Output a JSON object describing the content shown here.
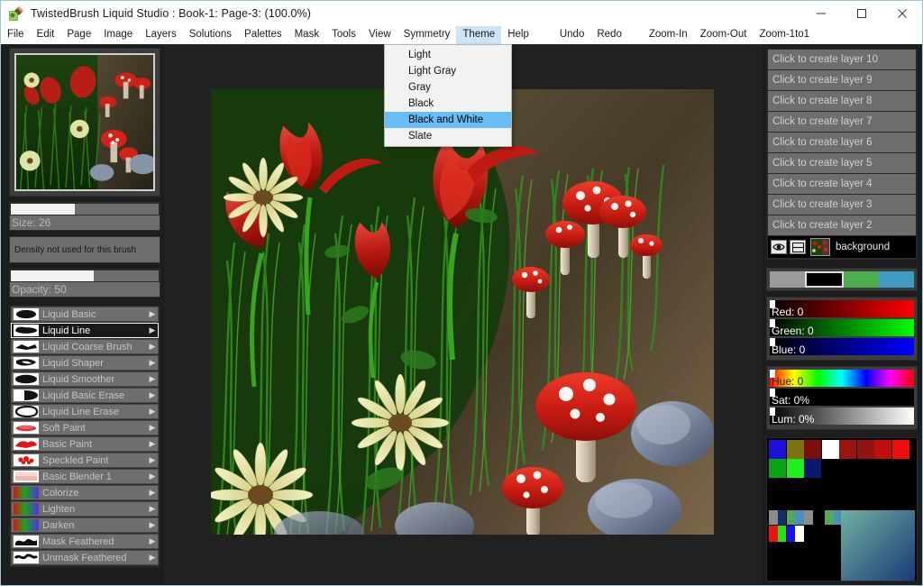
{
  "window": {
    "title": "TwistedBrush Liquid Studio : Book-1: Page-3:  (100.0%)",
    "icon": "app-icon",
    "minimize": "─",
    "maximize": "□",
    "close": "✕"
  },
  "menubar": {
    "items": [
      {
        "label": "File",
        "active": false
      },
      {
        "label": "Edit",
        "active": false
      },
      {
        "label": "Page",
        "active": false
      },
      {
        "label": "Image",
        "active": false
      },
      {
        "label": "Layers",
        "active": false
      },
      {
        "label": "Solutions",
        "active": false
      },
      {
        "label": "Palettes",
        "active": false
      },
      {
        "label": "Mask",
        "active": false
      },
      {
        "label": "Tools",
        "active": false
      },
      {
        "label": "View",
        "active": false
      },
      {
        "label": "Symmetry",
        "active": false
      },
      {
        "label": "Theme",
        "active": true
      },
      {
        "label": "Help",
        "active": false
      },
      {
        "label": "Undo",
        "active": false
      },
      {
        "label": "Redo",
        "active": false
      },
      {
        "label": "Zoom-In",
        "active": false
      },
      {
        "label": "Zoom-Out",
        "active": false
      },
      {
        "label": "Zoom-1to1",
        "active": false
      }
    ]
  },
  "theme_menu": {
    "open": true,
    "items": [
      {
        "label": "Light",
        "selected": false
      },
      {
        "label": "Light Gray",
        "selected": false
      },
      {
        "label": "Gray",
        "selected": false
      },
      {
        "label": "Black",
        "selected": false
      },
      {
        "label": "Black and White",
        "selected": true
      },
      {
        "label": "Slate",
        "selected": false
      }
    ],
    "highlight_color": "#68bdf6"
  },
  "brush_controls": {
    "size": {
      "label": "Size: 26",
      "value": 26,
      "fill_percent": 43
    },
    "density": {
      "label": "Density not used for this brush"
    },
    "opacity": {
      "label": "Opacity: 50",
      "value": 50,
      "fill_percent": 56
    }
  },
  "brush_list": {
    "items": [
      {
        "label": "Liquid Basic",
        "selected": false,
        "arrow": "▶"
      },
      {
        "label": "Liquid Line",
        "selected": true,
        "arrow": "▶"
      },
      {
        "label": "Liquid Coarse Brush",
        "selected": false,
        "arrow": "▶"
      },
      {
        "label": "Liquid Shaper",
        "selected": false,
        "arrow": "▶"
      },
      {
        "label": "Liquid Smoother",
        "selected": false,
        "arrow": "▶"
      },
      {
        "label": "Liquid Basic Erase",
        "selected": false,
        "arrow": "▶"
      },
      {
        "label": "Liquid Line Erase",
        "selected": false,
        "arrow": "▶"
      },
      {
        "label": "Soft Paint",
        "selected": false,
        "arrow": "▶"
      },
      {
        "label": "Basic Paint",
        "selected": false,
        "arrow": "▶"
      },
      {
        "label": "Speckled Paint",
        "selected": false,
        "arrow": "▶"
      },
      {
        "label": "Basic Blender 1",
        "selected": false,
        "arrow": "▶"
      },
      {
        "label": "Colorize",
        "selected": false,
        "arrow": "▶"
      },
      {
        "label": "Lighten",
        "selected": false,
        "arrow": "▶"
      },
      {
        "label": "Darken",
        "selected": false,
        "arrow": "▶"
      },
      {
        "label": "Mask Feathered",
        "selected": false,
        "arrow": "▶"
      },
      {
        "label": "Unmask Feathered",
        "selected": false,
        "arrow": "▶"
      }
    ]
  },
  "layers": {
    "create_rows": [
      "Click to create layer 10",
      "Click to create layer 9",
      "Click to create layer 8",
      "Click to create layer 7",
      "Click to create layer 6",
      "Click to create layer 5",
      "Click to create layer 4",
      "Click to create layer 3",
      "Click to create layer 2"
    ],
    "background": {
      "name": "background",
      "visibility_icon": "eye-icon",
      "merge_icon": "layer-merge-icon"
    }
  },
  "color": {
    "swatches": [
      {
        "name": "gray-swatch",
        "hex": "#9a9a9a",
        "selected": false
      },
      {
        "name": "black-swatch",
        "hex": "#000000",
        "selected": true
      },
      {
        "name": "green-swatch",
        "hex": "#4cae4c",
        "selected": false
      },
      {
        "name": "blue-swatch",
        "hex": "#3f9bc4",
        "selected": false
      }
    ],
    "channels": [
      {
        "name": "Red",
        "label": "Red: 0",
        "value": 0,
        "unit": "",
        "knob_percent": 0,
        "text_color": "#ffffff"
      },
      {
        "name": "Green",
        "label": "Green: 0",
        "value": 0,
        "unit": "",
        "knob_percent": 0,
        "text_color": "#ffffff"
      },
      {
        "name": "Blue",
        "label": "Blue: 0",
        "value": 0,
        "unit": "",
        "knob_percent": 0,
        "text_color": "#ffffff"
      }
    ],
    "hsl": [
      {
        "name": "Hue",
        "label": "Hue: 0",
        "value": 0,
        "unit": "",
        "knob_percent": 0,
        "text_color": "#222222"
      },
      {
        "name": "Sat",
        "label": "Sat: 0%",
        "value": 0,
        "unit": "%",
        "knob_percent": 0,
        "text_color": "#ffffff"
      },
      {
        "name": "Lum",
        "label": "Lum: 0%",
        "value": 0,
        "unit": "%",
        "knob_percent": 0,
        "text_color": "#ffffff"
      }
    ]
  },
  "palette": {
    "row1": [
      "#1a10d8",
      "#7c7213",
      "#7b0f0c",
      "#ffffff",
      "#9c1410",
      "#8f1410",
      "#c00f0b",
      "#f00c08"
    ],
    "row2": [
      "#0aa316",
      "#1df01d",
      "#0c1870"
    ],
    "row3": [
      "#8c8c8c",
      "#122c6e",
      "#56a75e",
      "#4a90b8",
      "#8c8c8c"
    ],
    "row3b": [
      "#56a75e",
      "#4a90b8"
    ],
    "row4": [
      "#f01010",
      "#18e818",
      "#1414f0",
      "#ffffff"
    ],
    "gradient_from": "#6fb0a0",
    "gradient_to": "#1b3a78"
  },
  "canvas": {
    "artwork_name": "mushroom-flower-meadow-artwork",
    "zoom": "100.0%"
  }
}
